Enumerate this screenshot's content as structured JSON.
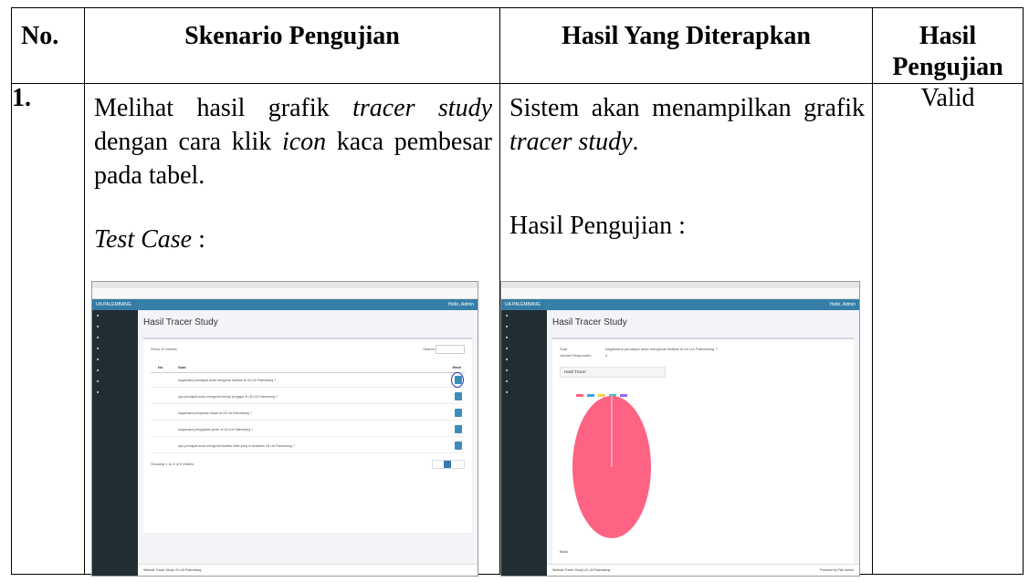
{
  "table": {
    "headers": {
      "no": "No.",
      "skenario": "Skenario Pengujian",
      "hasil_diterapkan": "Hasil Yang Diterapkan",
      "hasil_pengujian": "Hasil Pengujian"
    },
    "row": {
      "number": "1.",
      "skenario_parts": [
        "Melihat hasil grafik ",
        "tracer study",
        " dengan cara klik ",
        "icon",
        " kaca pembesar pada tabel."
      ],
      "test_case_label": "Test Case",
      "test_case_suffix": " :",
      "hasil_parts": [
        "Sistem akan menampilkan grafik ",
        "tracer study",
        "."
      ],
      "hasil_pengujian_label": "Hasil Pengujian :",
      "result": "Valid"
    }
  },
  "screenshot_left": {
    "brand": "UA PALEMBANG",
    "user": "Hello, Admin",
    "page_title": "Hasil Tracer Study",
    "show_entries": "Show 10 entries",
    "search_label": "Search:",
    "col_no": "No",
    "col_soal": "Soal",
    "col_hasil": "Hasil",
    "rows": [
      "bagaimana pendapat anda mengenai fasilitas di LB LIA Palembang ?",
      "apa pendapat anda mengenai kinerja pengajar di LB LIA Palembang ?",
      "bagaimana pelayanan staaa di LB LIA Palembang ?",
      "bagaimana pengajaran jantor di LB LIA Palembang ?",
      "apa pendapat anda mengenai fasilitas toilet yang di sediakan LB LIA Palembang ?"
    ],
    "showing": "Showing 1 to 5 of 5 entries",
    "footer": "Website Tracer Study LB LIA Palembang"
  },
  "screenshot_right": {
    "brand": "UA PALEMBANG",
    "user": "Hello, Admin",
    "page_title": "Hasil Tracer Study",
    "soal_label": "Soal",
    "soal_value": "bagaimana pendapat anda mengenai fasilitas di LB LIA Palembang ?",
    "responden_label": "Jumlah Responden",
    "responden_value": "2",
    "chart_title": "Hasil Tracer",
    "back": "Back",
    "footer": "Website Tracer Study LB LIA Palembang",
    "powered": "Powered by Pike Admin"
  },
  "colors": {
    "pie": "#ff6384",
    "topbar": "#367fa9",
    "sidebar": "#222d32",
    "action_button": "#3c8dbc"
  }
}
